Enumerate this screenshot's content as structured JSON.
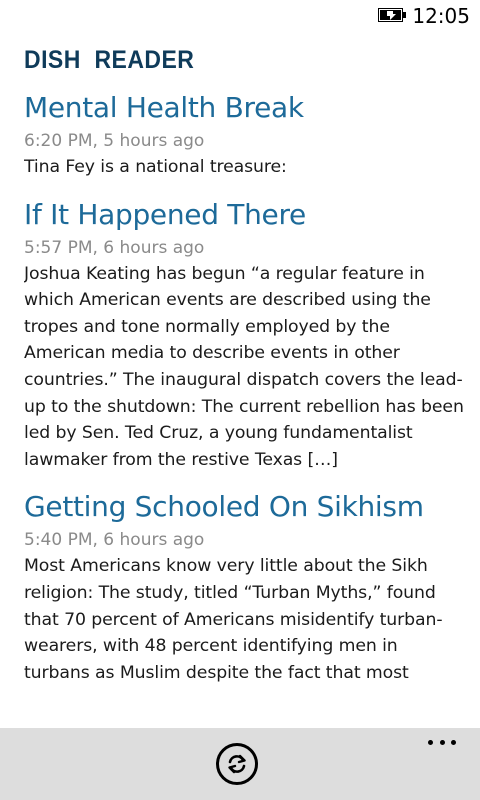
{
  "status_bar": {
    "time": "12:05",
    "battery_icon": "battery-charging-icon"
  },
  "app": {
    "title": "DISH  READER"
  },
  "articles": [
    {
      "title": "Mental Health Break",
      "meta": "6:20 PM, 5 hours ago",
      "summary": "Tina Fey is a national treasure:"
    },
    {
      "title": "If It Happened There",
      "meta": "5:57 PM, 6 hours ago",
      "summary": "Joshua Keating has begun “a regular feature in which American events are described using the tropes and tone normally employed by the American media to describe events in other countries.” The inaugural dispatch covers the lead-up to the shutdown: The current rebellion has been led by Sen. Ted Cruz, a young fundamentalist lawmaker from the restive Texas […]"
    },
    {
      "title": "Getting Schooled On Sikhism",
      "meta": "5:40 PM, 6 hours ago",
      "summary": "Most Americans know very little about the Sikh religion: The study, titled “Turban Myths,” found that 70 percent of Americans misidentify turban-wearers, with 48 percent identifying men in turbans as Muslim despite the fact that most"
    }
  ],
  "app_bar": {
    "refresh_icon": "refresh-icon",
    "more_icon": "more-dots-icon"
  },
  "colors": {
    "accent": "#1d6a99",
    "brand": "#0f3b5a",
    "meta_text": "#8a8a8a",
    "app_bar_bg": "#dddddd"
  }
}
